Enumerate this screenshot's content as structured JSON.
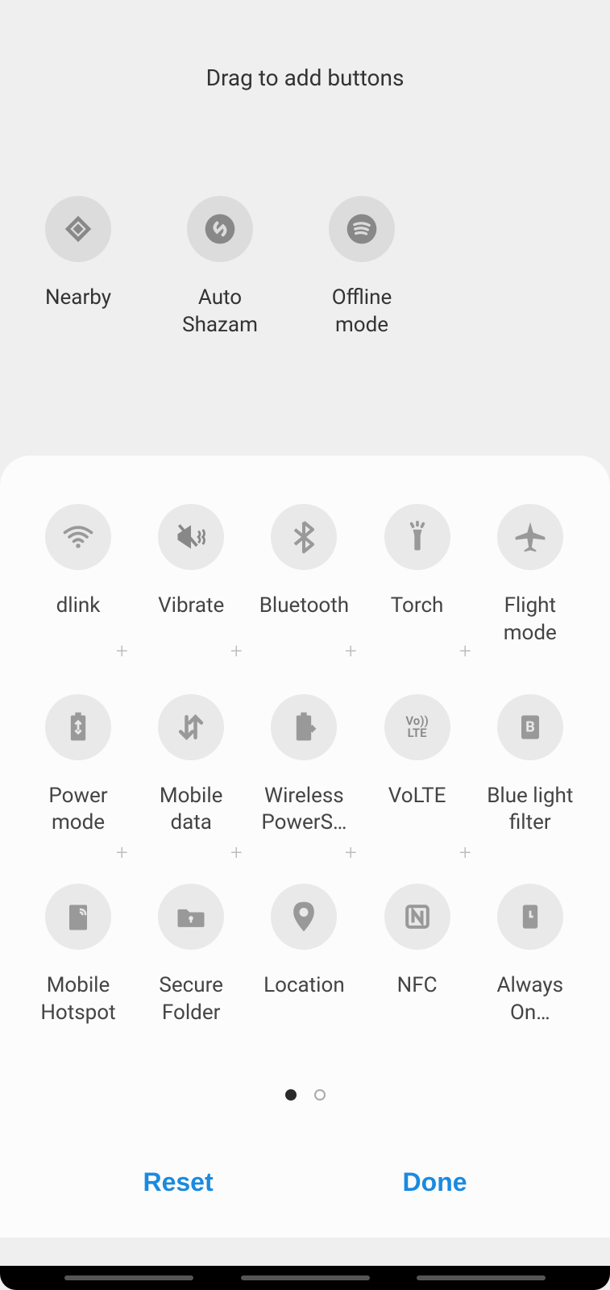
{
  "title": "Drag to add buttons",
  "available": [
    {
      "name": "nearby",
      "label": "Nearby"
    },
    {
      "name": "auto-shazam",
      "label": "Auto\nShazam"
    },
    {
      "name": "offline-mode",
      "label": "Offline\nmode"
    }
  ],
  "panel_items": [
    {
      "name": "wifi",
      "label": "dlink"
    },
    {
      "name": "vibrate",
      "label": "Vibrate"
    },
    {
      "name": "bluetooth",
      "label": "Bluetooth"
    },
    {
      "name": "torch",
      "label": "Torch"
    },
    {
      "name": "flight-mode",
      "label": "Flight\nmode"
    },
    {
      "name": "power-mode",
      "label": "Power\nmode"
    },
    {
      "name": "mobile-data",
      "label": "Mobile\ndata"
    },
    {
      "name": "wireless-powershare",
      "label": "Wireless\nPowerS…"
    },
    {
      "name": "volte",
      "label": "VoLTE"
    },
    {
      "name": "blue-light-filter",
      "label": "Blue light\nfilter"
    },
    {
      "name": "mobile-hotspot",
      "label": "Mobile\nHotspot"
    },
    {
      "name": "secure-folder",
      "label": "Secure\nFolder"
    },
    {
      "name": "location",
      "label": "Location"
    },
    {
      "name": "nfc",
      "label": "NFC"
    },
    {
      "name": "always-on",
      "label": "Always\nOn…"
    }
  ],
  "pagination": {
    "total": 2,
    "active": 0
  },
  "actions": {
    "reset": "Reset",
    "done": "Done"
  },
  "colors": {
    "accent": "#1a8ae0",
    "icon": "#888888"
  }
}
